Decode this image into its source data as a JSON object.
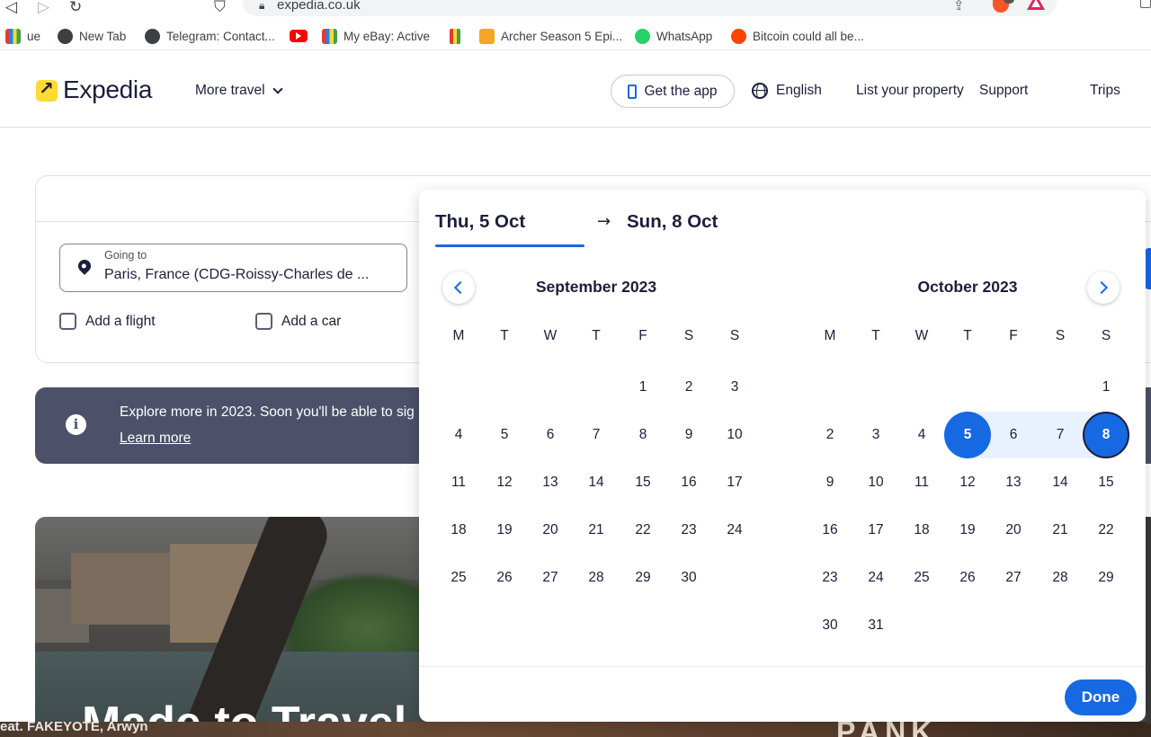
{
  "browser": {
    "url": "expedia.co.uk",
    "bookmarks": [
      {
        "label": "ue",
        "icon": "shopping-bag-icon"
      },
      {
        "label": "New Tab",
        "icon": "globe-icon"
      },
      {
        "label": "Telegram: Contact...",
        "icon": "globe-icon"
      },
      {
        "label": "",
        "icon": "youtube-icon"
      },
      {
        "label": "My eBay: Active",
        "icon": "shopping-bag-icon"
      },
      {
        "label": "",
        "icon": "shopping-bag-icon"
      },
      {
        "label": "Archer Season 5 Epi...",
        "icon": "archer-icon"
      },
      {
        "label": "WhatsApp",
        "icon": "whatsapp-icon"
      },
      {
        "label": "Bitcoin could all be...",
        "icon": "reddit-icon"
      }
    ]
  },
  "header": {
    "logo_text": "Expedia",
    "more_travel": "More travel",
    "get_app": "Get the app",
    "language": "English",
    "list_property": "List your property",
    "support": "Support",
    "trips": "Trips"
  },
  "search": {
    "going_to_label": "Going to",
    "going_to_value": "Paris, France (CDG-Roissy-Charles de ...",
    "add_flight": "Add a flight",
    "add_car": "Add a car"
  },
  "banner": {
    "text": "Explore more in 2023. Soon you'll be able to sig",
    "link": "Learn more"
  },
  "hero": {
    "title": "Made to Travel"
  },
  "footer_strip": {
    "text": "eat. FAKEYOTE, Arwyn",
    "right_text": "PANK"
  },
  "picker": {
    "start_date": "Thu, 5 Oct",
    "arrow": "→",
    "end_date": "Sun, 8 Oct",
    "weekdays": [
      "M",
      "T",
      "W",
      "T",
      "F",
      "S",
      "S"
    ],
    "left_month": {
      "title": "September 2023",
      "weeks": [
        [
          "",
          "",
          "",
          "",
          "1",
          "2",
          "3"
        ],
        [
          "4",
          "5",
          "6",
          "7",
          "8",
          "9",
          "10"
        ],
        [
          "11",
          "12",
          "13",
          "14",
          "15",
          "16",
          "17"
        ],
        [
          "18",
          "19",
          "20",
          "21",
          "22",
          "23",
          "24"
        ],
        [
          "25",
          "26",
          "27",
          "28",
          "29",
          "30",
          ""
        ]
      ]
    },
    "right_month": {
      "title": "October 2023",
      "weeks": [
        [
          "",
          "",
          "",
          "",
          "",
          "",
          "1"
        ],
        [
          "2",
          "3",
          "4",
          "5",
          "6",
          "7",
          "8"
        ],
        [
          "9",
          "10",
          "11",
          "12",
          "13",
          "14",
          "15"
        ],
        [
          "16",
          "17",
          "18",
          "19",
          "20",
          "21",
          "22"
        ],
        [
          "23",
          "24",
          "25",
          "26",
          "27",
          "28",
          "29"
        ],
        [
          "30",
          "31",
          "",
          "",
          "",
          "",
          ""
        ]
      ],
      "selected_start": "5",
      "selected_end": "8"
    },
    "done": "Done"
  },
  "colors": {
    "accent": "#1668e3",
    "brand_yellow": "#fddb32",
    "banner_bg": "#4c5169",
    "range_bg": "#e8f1fd",
    "text": "#1b1f3b"
  }
}
